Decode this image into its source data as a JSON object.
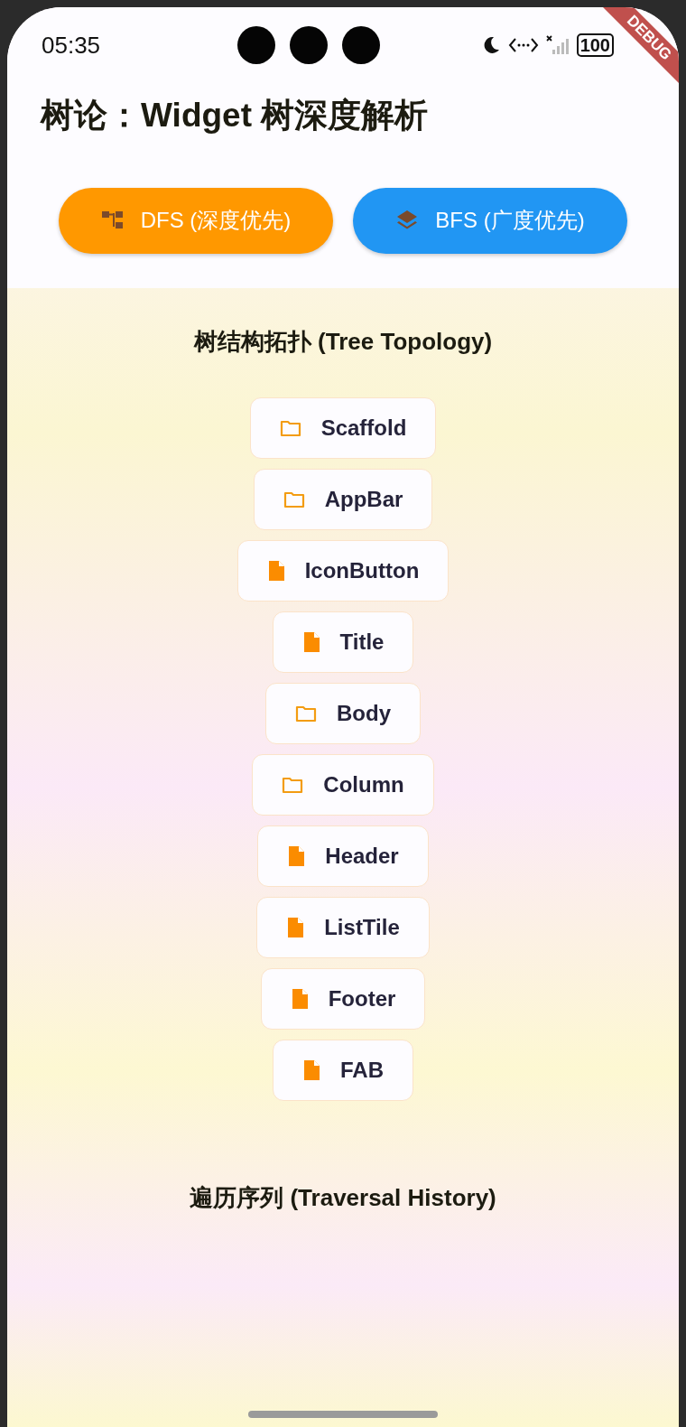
{
  "status_bar": {
    "time": "05:35",
    "battery": "100"
  },
  "debug_banner": "DEBUG",
  "title": "树论：Widget 树深度解析",
  "buttons": [
    {
      "label": "DFS (深度优先)",
      "kind": "dfs",
      "color": "#ff9800"
    },
    {
      "label": "BFS (广度优先)",
      "kind": "bfs",
      "color": "#2196f3"
    }
  ],
  "tree": {
    "title": "树结构拓扑 (Tree Topology)",
    "nodes": [
      {
        "label": "Scaffold",
        "kind": "folder"
      },
      {
        "label": "AppBar",
        "kind": "folder"
      },
      {
        "label": "IconButton",
        "kind": "file"
      },
      {
        "label": "Title",
        "kind": "file"
      },
      {
        "label": "Body",
        "kind": "folder"
      },
      {
        "label": "Column",
        "kind": "folder"
      },
      {
        "label": "Header",
        "kind": "file"
      },
      {
        "label": "ListTile",
        "kind": "file"
      },
      {
        "label": "Footer",
        "kind": "file"
      },
      {
        "label": "FAB",
        "kind": "file"
      }
    ]
  },
  "history": {
    "title": "遍历序列 (Traversal History)"
  }
}
